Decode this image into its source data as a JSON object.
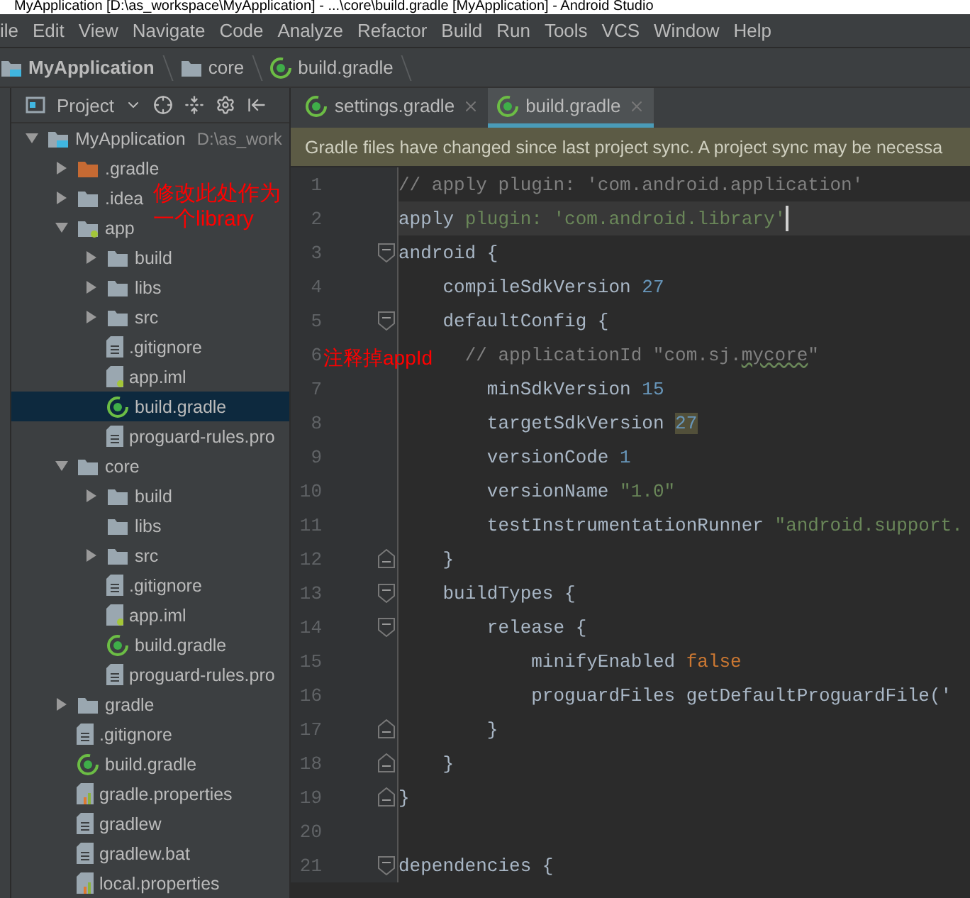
{
  "window": {
    "title": "MyApplication [D:\\as_workspace\\MyApplication] - ...\\core\\build.gradle [MyApplication] - Android Studio"
  },
  "menu": [
    "ile",
    "Edit",
    "View",
    "Navigate",
    "Code",
    "Analyze",
    "Refactor",
    "Build",
    "Run",
    "Tools",
    "VCS",
    "Window",
    "Help"
  ],
  "breadcrumb": [
    {
      "label": "MyApplication",
      "kind": "project"
    },
    {
      "label": "core",
      "kind": "folder"
    },
    {
      "label": "build.gradle",
      "kind": "gradle"
    }
  ],
  "project_panel": {
    "title": "Project",
    "tree": [
      {
        "name": "MyApplication",
        "path": "D:\\as_work",
        "kind": "project",
        "expanded": true,
        "selected": false,
        "children": [
          {
            "name": ".gradle",
            "kind": "excluded-folder",
            "expanded": false,
            "selected": false
          },
          {
            "name": ".idea",
            "kind": "folder",
            "expanded": false,
            "selected": false
          },
          {
            "name": "app",
            "kind": "module",
            "expanded": true,
            "selected": false,
            "children": [
              {
                "name": "build",
                "kind": "folder",
                "expanded": false,
                "selected": false
              },
              {
                "name": "libs",
                "kind": "folder",
                "expanded": false,
                "selected": false
              },
              {
                "name": "src",
                "kind": "folder",
                "expanded": false,
                "selected": false
              },
              {
                "name": ".gitignore",
                "kind": "file",
                "selected": false
              },
              {
                "name": "app.iml",
                "kind": "iml",
                "selected": false
              },
              {
                "name": "build.gradle",
                "kind": "gradle",
                "selected": true
              },
              {
                "name": "proguard-rules.pro",
                "kind": "file",
                "selected": false
              }
            ]
          },
          {
            "name": "core",
            "kind": "module-plain",
            "expanded": true,
            "selected": false,
            "children": [
              {
                "name": "build",
                "kind": "folder",
                "expanded": false,
                "selected": false
              },
              {
                "name": "libs",
                "kind": "empty-folder",
                "selected": false
              },
              {
                "name": "src",
                "kind": "folder",
                "expanded": false,
                "selected": false
              },
              {
                "name": ".gitignore",
                "kind": "file",
                "selected": false
              },
              {
                "name": "app.iml",
                "kind": "iml",
                "selected": false
              },
              {
                "name": "build.gradle",
                "kind": "gradle",
                "selected": false
              },
              {
                "name": "proguard-rules.pro",
                "kind": "file",
                "selected": false
              }
            ]
          },
          {
            "name": "gradle",
            "kind": "folder",
            "expanded": false,
            "selected": false
          },
          {
            "name": ".gitignore",
            "kind": "file",
            "selected": false
          },
          {
            "name": "build.gradle",
            "kind": "gradle",
            "selected": false
          },
          {
            "name": "gradle.properties",
            "kind": "properties",
            "selected": false
          },
          {
            "name": "gradlew",
            "kind": "file",
            "selected": false
          },
          {
            "name": "gradlew.bat",
            "kind": "file",
            "selected": false
          },
          {
            "name": "local.properties",
            "kind": "properties",
            "selected": false
          }
        ]
      }
    ]
  },
  "editor": {
    "tabs": [
      {
        "label": "settings.gradle",
        "selected": false
      },
      {
        "label": "build.gradle",
        "selected": true
      }
    ],
    "notification": "Gradle files have changed since last project sync. A project sync may be necessa",
    "lines": [
      {
        "number": "1",
        "kind": "plain",
        "current": false,
        "tokens": [
          {
            "kind": "comment",
            "text": "// apply plugin: 'com.android.application'"
          }
        ]
      },
      {
        "number": "2",
        "kind": "plain",
        "current": true,
        "tokens": [
          {
            "kind": "plain",
            "text": "apply "
          },
          {
            "kind": "string",
            "text": "plugin: 'com.android.library'"
          }
        ]
      },
      {
        "number": "3",
        "kind": "fold-start",
        "current": false,
        "tokens": [
          {
            "kind": "plain",
            "text": "android {"
          }
        ]
      },
      {
        "number": "4",
        "kind": "plain",
        "current": false,
        "tokens": [
          {
            "kind": "plain",
            "text": "    compileSdkVersion "
          },
          {
            "kind": "number",
            "text": "27"
          }
        ]
      },
      {
        "number": "5",
        "kind": "fold-start",
        "current": false,
        "tokens": [
          {
            "kind": "plain",
            "text": "    defaultConfig {"
          }
        ]
      },
      {
        "number": "6",
        "kind": "plain",
        "current": false,
        "tokens": [
          {
            "kind": "comment",
            "text": "      // applicationId \"com.sj."
          },
          {
            "kind": "typo",
            "text": "mycore"
          },
          {
            "kind": "comment",
            "text": "\""
          }
        ]
      },
      {
        "number": "7",
        "kind": "plain",
        "current": false,
        "tokens": [
          {
            "kind": "plain",
            "text": "        minSdkVersion "
          },
          {
            "kind": "number",
            "text": "15"
          }
        ]
      },
      {
        "number": "8",
        "kind": "plain",
        "current": false,
        "tokens": [
          {
            "kind": "plain",
            "text": "        targetSdkVersion "
          },
          {
            "kind": "number-highlight",
            "text": "27"
          }
        ]
      },
      {
        "number": "9",
        "kind": "plain",
        "current": false,
        "tokens": [
          {
            "kind": "plain",
            "text": "        versionCode "
          },
          {
            "kind": "number",
            "text": "1"
          }
        ]
      },
      {
        "number": "10",
        "kind": "plain",
        "current": false,
        "tokens": [
          {
            "kind": "plain",
            "text": "        versionName "
          },
          {
            "kind": "string",
            "text": "\"1.0\""
          }
        ]
      },
      {
        "number": "11",
        "kind": "plain",
        "current": false,
        "tokens": [
          {
            "kind": "plain",
            "text": "        testInstrumentationRunner "
          },
          {
            "kind": "string",
            "text": "\"android.support."
          }
        ]
      },
      {
        "number": "12",
        "kind": "fold-end",
        "current": false,
        "tokens": [
          {
            "kind": "plain",
            "text": "    }"
          }
        ]
      },
      {
        "number": "13",
        "kind": "fold-start",
        "current": false,
        "tokens": [
          {
            "kind": "plain",
            "text": "    buildTypes {"
          }
        ]
      },
      {
        "number": "14",
        "kind": "fold-start",
        "current": false,
        "tokens": [
          {
            "kind": "plain",
            "text": "        release {"
          }
        ]
      },
      {
        "number": "15",
        "kind": "plain",
        "current": false,
        "tokens": [
          {
            "kind": "plain",
            "text": "            minifyEnabled "
          },
          {
            "kind": "keyword",
            "text": "false"
          }
        ]
      },
      {
        "number": "16",
        "kind": "plain",
        "current": false,
        "tokens": [
          {
            "kind": "plain",
            "text": "            proguardFiles getDefaultProguardFile('"
          }
        ]
      },
      {
        "number": "17",
        "kind": "fold-end",
        "current": false,
        "tokens": [
          {
            "kind": "plain",
            "text": "        }"
          }
        ]
      },
      {
        "number": "18",
        "kind": "fold-end",
        "current": false,
        "tokens": [
          {
            "kind": "plain",
            "text": "    }"
          }
        ]
      },
      {
        "number": "19",
        "kind": "fold-end",
        "current": false,
        "tokens": [
          {
            "kind": "plain",
            "text": "}"
          }
        ]
      },
      {
        "number": "20",
        "kind": "plain",
        "current": false
      },
      {
        "number": "21",
        "kind": "fold-start",
        "current": false,
        "tokens": [
          {
            "kind": "plain",
            "text": "dependencies {"
          }
        ]
      }
    ]
  },
  "annotations": [
    {
      "text": "修改此处作为一个library"
    },
    {
      "text": "注释掉appId"
    }
  ]
}
